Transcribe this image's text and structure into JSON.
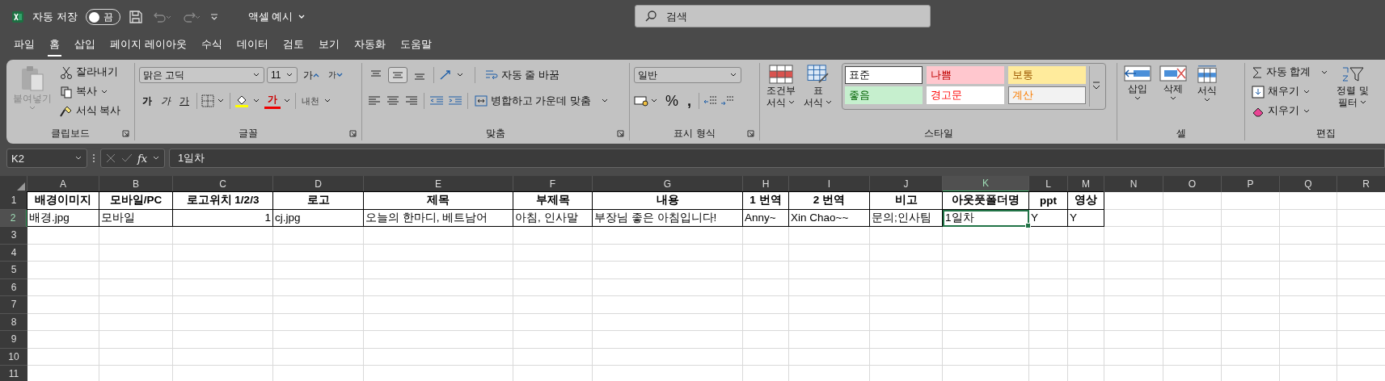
{
  "title_bar": {
    "autosave_label": "자동 저장",
    "autosave_toggle": {
      "on": false,
      "label": "끔"
    },
    "file_name": "액셀 예시",
    "search": {
      "placeholder": "검색"
    }
  },
  "menu_tabs": [
    {
      "label": "파일",
      "selected": false
    },
    {
      "label": "홈",
      "selected": true
    },
    {
      "label": "삽입",
      "selected": false
    },
    {
      "label": "페이지 레이아웃",
      "selected": false
    },
    {
      "label": "수식",
      "selected": false
    },
    {
      "label": "데이터",
      "selected": false
    },
    {
      "label": "검토",
      "selected": false
    },
    {
      "label": "보기",
      "selected": false
    },
    {
      "label": "자동화",
      "selected": false
    },
    {
      "label": "도움말",
      "selected": false
    }
  ],
  "ribbon": {
    "clipboard": {
      "label": "클립보드",
      "paste": {
        "label": "붙여넣기",
        "disabled": true
      },
      "cut": "잘라내기",
      "copy": "복사",
      "format_painter": "서식 복사"
    },
    "font": {
      "label": "글꼴",
      "font_name": "맑은 고딕",
      "font_size": "11",
      "grow": "가",
      "shrink": "가",
      "bold": "가",
      "italic": "가",
      "underline": "가",
      "font_color": "가",
      "phonetic": "내천"
    },
    "alignment": {
      "label": "맞춤",
      "vertical_align": [
        {
          "kind": "top",
          "selected": false
        },
        {
          "kind": "middle",
          "selected": true
        },
        {
          "kind": "bottom",
          "selected": false
        }
      ],
      "wrap_text": "자동 줄 바꿈",
      "merge_center": "병합하고 가운데 맞춤"
    },
    "number": {
      "label": "표시 형식",
      "format": "일반",
      "percent": "%",
      "comma": ","
    },
    "styles": {
      "label": "스타일",
      "conditional": [
        "조건부",
        "서식"
      ],
      "format_table": [
        "표",
        "서식"
      ],
      "cell_styles": [
        {
          "label": "표준",
          "kind": "normal"
        },
        {
          "label": "나쁨",
          "kind": "bad"
        },
        {
          "label": "보통",
          "kind": "neutral"
        },
        {
          "label": "좋음",
          "kind": "good"
        },
        {
          "label": "경고문",
          "kind": "warning"
        },
        {
          "label": "계산",
          "kind": "calculation"
        }
      ]
    },
    "cells": {
      "label": "셀",
      "insert": "삽입",
      "delete": "삭제",
      "format": "서식"
    },
    "editing": {
      "label": "편집",
      "autosum": "자동 합계",
      "fill": "채우기",
      "clear": "지우기",
      "sort_filter": [
        "정렬 및",
        "필터"
      ]
    }
  },
  "formula_bar": {
    "name_box": "K2",
    "fx": "fx",
    "formula": "1일차"
  },
  "sheet": {
    "columns": [
      {
        "letter": "A",
        "selected": false
      },
      {
        "letter": "B",
        "selected": false
      },
      {
        "letter": "C",
        "selected": false
      },
      {
        "letter": "D",
        "selected": false
      },
      {
        "letter": "E",
        "selected": false
      },
      {
        "letter": "F",
        "selected": false
      },
      {
        "letter": "G",
        "selected": false
      },
      {
        "letter": "H",
        "selected": false
      },
      {
        "letter": "I",
        "selected": false
      },
      {
        "letter": "J",
        "selected": false
      },
      {
        "letter": "K",
        "selected": true
      },
      {
        "letter": "L",
        "selected": false
      },
      {
        "letter": "M",
        "selected": false
      },
      {
        "letter": "N",
        "selected": false
      },
      {
        "letter": "O",
        "selected": false
      },
      {
        "letter": "P",
        "selected": false
      },
      {
        "letter": "Q",
        "selected": false
      },
      {
        "letter": "R",
        "selected": false
      }
    ],
    "rows": [
      {
        "number": "1",
        "selected": false,
        "cells": [
          {
            "text": "배경이미지",
            "kind": "header",
            "selected": false
          },
          {
            "text": "모바일/PC",
            "kind": "header",
            "selected": false
          },
          {
            "text": "로고위치 1/2/3",
            "kind": "header",
            "selected": false
          },
          {
            "text": "로고",
            "kind": "header",
            "selected": false
          },
          {
            "text": "제목",
            "kind": "header",
            "selected": false
          },
          {
            "text": "부제목",
            "kind": "header",
            "selected": false
          },
          {
            "text": "내용",
            "kind": "header",
            "selected": false
          },
          {
            "text": "1 번역",
            "kind": "header",
            "selected": false
          },
          {
            "text": "2 번역",
            "kind": "header",
            "selected": false
          },
          {
            "text": "비고",
            "kind": "header",
            "selected": false
          },
          {
            "text": "아웃풋폴더명",
            "kind": "header",
            "selected": false
          },
          {
            "text": "ppt",
            "kind": "header",
            "selected": false
          },
          {
            "text": "영상",
            "kind": "header",
            "selected": false
          }
        ]
      },
      {
        "number": "2",
        "selected": true,
        "cells": [
          {
            "text": "배경.jpg",
            "kind": "text",
            "selected": false
          },
          {
            "text": "모바일",
            "kind": "text",
            "selected": false
          },
          {
            "text": "1",
            "kind": "number",
            "selected": false
          },
          {
            "text": "cj.jpg",
            "kind": "text",
            "selected": false
          },
          {
            "text": "오늘의 한마디, 베트남어",
            "kind": "text",
            "selected": false
          },
          {
            "text": "아침, 인사말",
            "kind": "text",
            "selected": false
          },
          {
            "text": "부장님 좋은 아침입니다!",
            "kind": "text",
            "selected": false
          },
          {
            "text": "Anny~",
            "kind": "text",
            "selected": false
          },
          {
            "text": "Xin Chao~~",
            "kind": "text",
            "selected": false
          },
          {
            "text": "문의;인사팀",
            "kind": "text",
            "selected": false
          },
          {
            "text": "1일차",
            "kind": "text",
            "selected": true
          },
          {
            "text": "Y",
            "kind": "text",
            "selected": false
          },
          {
            "text": "Y",
            "kind": "text",
            "selected": false
          }
        ]
      },
      {
        "number": "3",
        "selected": false
      },
      {
        "number": "4",
        "selected": false
      },
      {
        "number": "5",
        "selected": false
      },
      {
        "number": "6",
        "selected": false
      },
      {
        "number": "7",
        "selected": false
      },
      {
        "number": "8",
        "selected": false
      },
      {
        "number": "9",
        "selected": false
      },
      {
        "number": "10",
        "selected": false
      },
      {
        "number": "11",
        "selected": false
      }
    ]
  }
}
